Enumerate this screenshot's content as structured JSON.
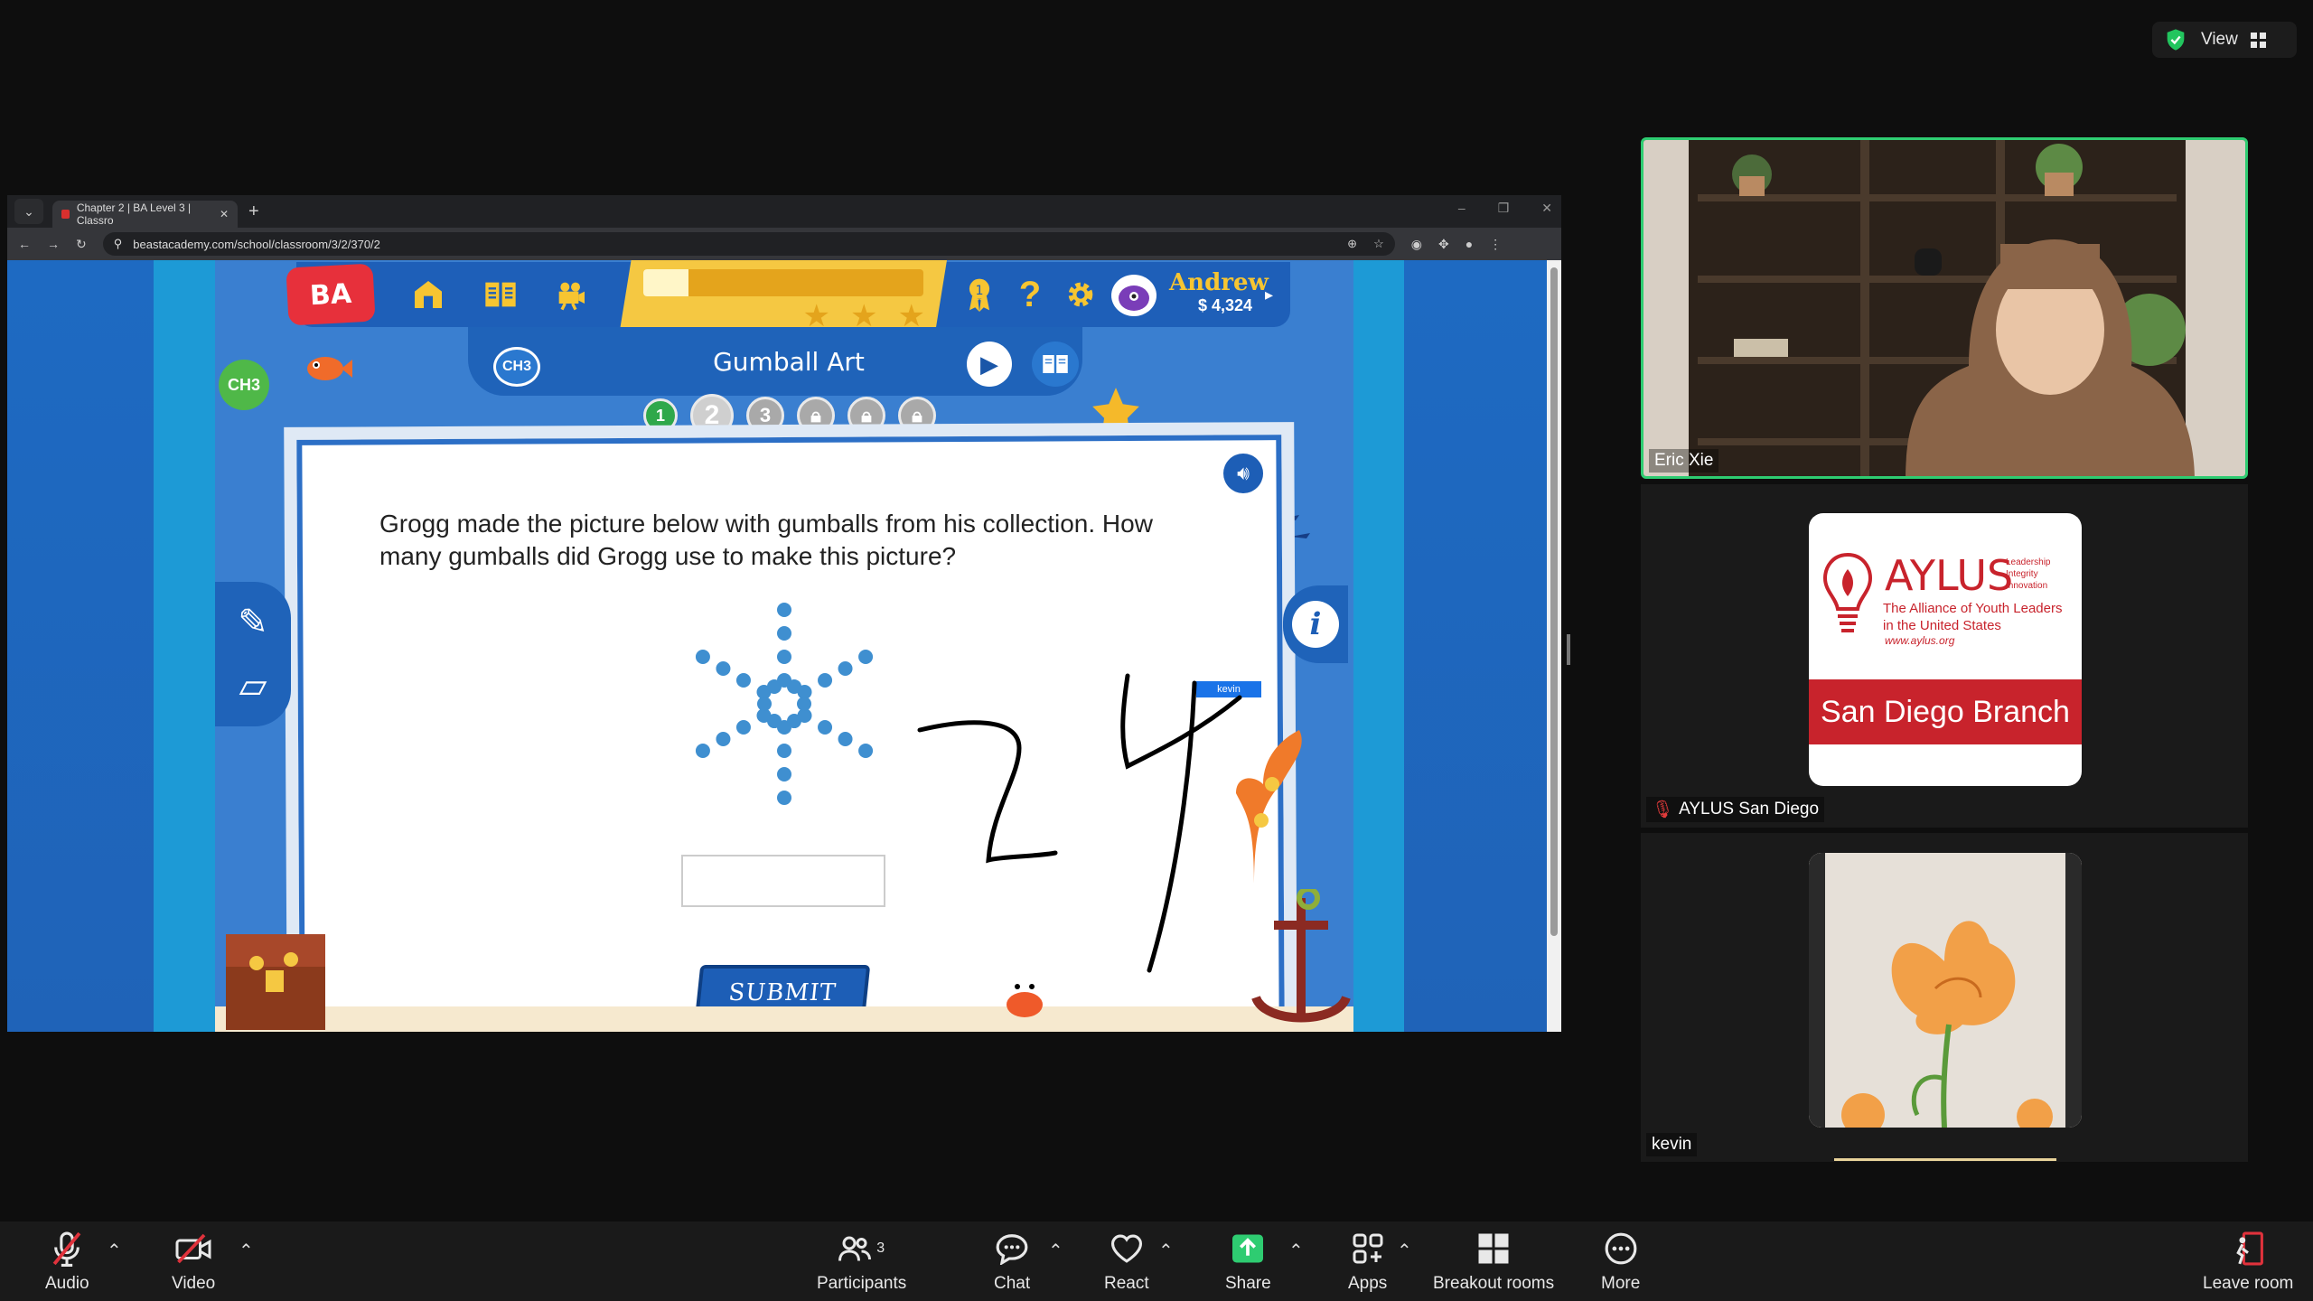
{
  "zoom_header": {
    "view_label": "View"
  },
  "browser": {
    "tab_title": "Chapter 2 | BA Level 3 | Classro",
    "url": "beastacademy.com/school/classroom/3/2/370/2"
  },
  "game": {
    "logo": "BA",
    "user_name": "Andrew",
    "coins": "$ 4,324",
    "chapter_label": "CH3",
    "chapter_label_small": "CH3",
    "title": "Gumball Art",
    "steps": [
      "1",
      "2",
      "3"
    ],
    "question": "Grogg made the picture below with gumballs from his collection. How many gumballs did Grogg use to make this picture?",
    "answer_value": "",
    "submit_label": "SUBMIT",
    "annotator_label": "kevin",
    "handwritten_answer": "24",
    "progress_stars": 3
  },
  "participants": {
    "tile1_name": "Eric Xie",
    "tile2_name": "AYLUS San Diego",
    "tile3_name": "kevin",
    "aylus_logo": {
      "title": "AYLUS",
      "tagline": [
        "Leadership",
        "Integrity",
        "Innovation"
      ],
      "subtitle": "The Alliance of Youth Leaders in the United States",
      "url": "www.aylus.org",
      "branch": "San Diego Branch"
    }
  },
  "toolbar": {
    "audio": "Audio",
    "video": "Video",
    "participants": "Participants",
    "participant_count": "3",
    "chat": "Chat",
    "react": "React",
    "share": "Share",
    "apps": "Apps",
    "breakout": "Breakout rooms",
    "more": "More",
    "leave": "Leave room"
  },
  "colors": {
    "accent_green": "#2ecc71",
    "game_blue": "#1d5eb6",
    "aylus_red": "#c8232c",
    "share_green": "#2ecc71"
  }
}
